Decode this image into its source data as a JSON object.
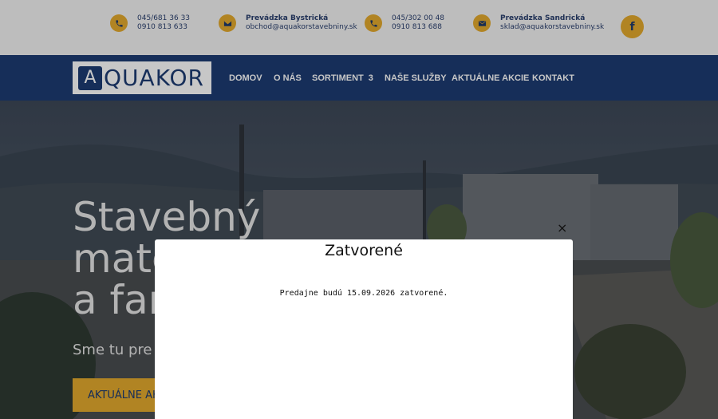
{
  "topbar": {
    "contacts": [
      {
        "icon": "phone-icon",
        "line1": "045/681 36 33",
        "line2": "0910 813 633"
      },
      {
        "icon": "email-icon",
        "line1": "Prevádzka Bystrická",
        "line2": "obchod@aquakorstavebniny.sk"
      },
      {
        "icon": "phone-icon",
        "line1": "045/302 00 48",
        "line2": "0910 813 688"
      },
      {
        "icon": "email-icon",
        "line1": "Prevádzka Sandrická",
        "line2": "sklad@aquakorstavebniny.sk"
      }
    ],
    "social": {
      "icon": "facebook-icon",
      "label": "f"
    }
  },
  "nav": {
    "logo_text": "QUAKOR",
    "logo_mark": "A",
    "items": [
      {
        "label": "DOMOV"
      },
      {
        "label": "O NÁS"
      },
      {
        "label": "SORTIMENT",
        "arrow": "3"
      },
      {
        "label": "NAŠE SLUŽBY"
      },
      {
        "label": "AKTUÁLNE AKCIE"
      },
      {
        "label": "KONTAKT"
      }
    ]
  },
  "hero": {
    "title_line1": "Stavebný",
    "title_line2": "mate",
    "title_line3": "a far",
    "subtitle": "Sme tu pre",
    "button": "AKTUÁLNE AK"
  },
  "popup": {
    "title": "Zatvorené",
    "message": "Predajne budú 15.09.2026 zatvorené.",
    "close": "×"
  },
  "colors": {
    "accent": "#e3a92e",
    "brand": "#1d3b72"
  }
}
